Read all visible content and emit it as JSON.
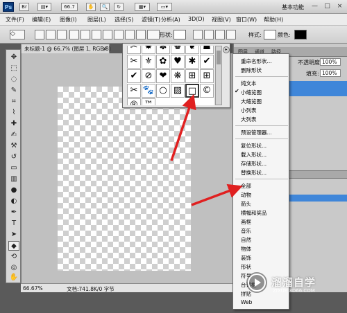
{
  "titlebar": {
    "app_icon": "Ps",
    "bridge_btn": "Br",
    "zoom": "66.7",
    "workspace": "基本功能",
    "win_buttons": [
      "—",
      "□",
      "×"
    ]
  },
  "menubar": {
    "items": [
      "文件(F)",
      "编辑(E)",
      "图像(I)",
      "图层(L)",
      "选择(S)",
      "滤镜(T)",
      "分析(A)",
      "3D(D)",
      "视图(V)",
      "窗口(W)",
      "帮助(H)"
    ]
  },
  "options_bar": {
    "shape_label": "形状:",
    "style_label": "样式:",
    "color_label": "颜色:",
    "colors": {
      "foreground": "#000000",
      "style_swatch": "#ffffff"
    }
  },
  "document": {
    "tab_title": "未标题-1 @ 66.7% (图层 1, RGB/8)",
    "tab_close": "×",
    "status_zoom": "66.67%",
    "status_doc": "文档:741.8K/0 字节"
  },
  "shape_picker": {
    "cells": [
      "✂",
      "✸",
      "✽",
      "♚",
      "❦",
      "☗",
      "✂",
      "⚜",
      "✿",
      "♥",
      "✱",
      "✔",
      "⊘",
      "❤",
      "❋",
      "⊞",
      "🐾",
      "○",
      "▨",
      "□",
      "©",
      "®",
      "™"
    ],
    "menu_button": "▸"
  },
  "right_panel": {
    "tabs": [
      "图层",
      "通道",
      "路径"
    ],
    "opacity_label": "不透明度:",
    "opacity_value": "100%",
    "fill_label": "填充:",
    "fill_value": "100%"
  },
  "shape_menu": {
    "items": [
      "重命名形状...",
      "删除形状",
      "纯文本",
      "小缩览图",
      "大缩览图",
      "小列表",
      "大列表",
      "预设管理器...",
      "复位形状...",
      "载入形状...",
      "存储形状...",
      "替换形状...",
      "全部",
      "动物",
      "箭头",
      "横幅和奖品",
      "画框",
      "音乐",
      "自然",
      "物体",
      "装饰",
      "形状",
      "符号",
      "台词框",
      "拼贴",
      "Web"
    ],
    "checked_item": "小缩览图",
    "check_mark": "✔"
  },
  "watermark": {
    "title": "溜溜自学",
    "url": "ZIXUE.3D66.COM"
  },
  "colors": {
    "accent_blue": "#3f86d9",
    "arrow_red": "#e02020"
  }
}
